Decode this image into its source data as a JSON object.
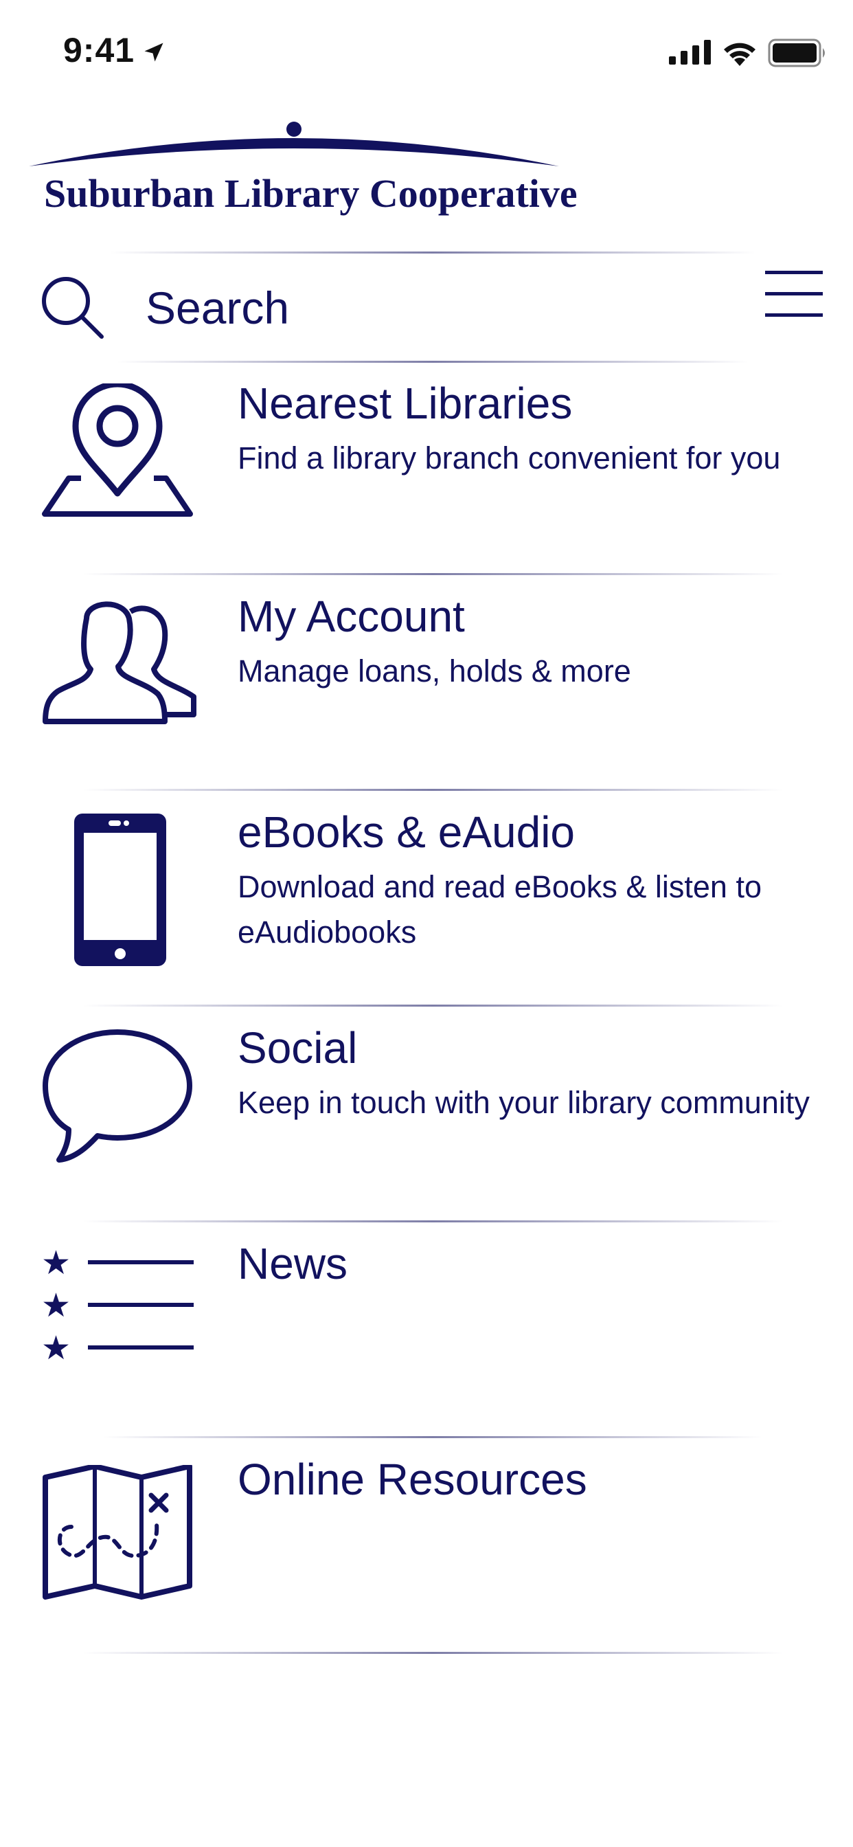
{
  "status_bar": {
    "time": "9:41",
    "icons": [
      "location-arrow-icon",
      "signal-icon",
      "wifi-icon",
      "battery-icon"
    ]
  },
  "header": {
    "logo_text": "Suburban Library Cooperative"
  },
  "search": {
    "placeholder": "Search",
    "value": ""
  },
  "menu": {
    "items": [
      {
        "title": "Nearest Libraries",
        "subtitle": "Find a library branch convenient for you",
        "icon": "map-pin-icon"
      },
      {
        "title": "My Account",
        "subtitle": "Manage loans, holds & more",
        "icon": "users-icon"
      },
      {
        "title": "eBooks & eAudio",
        "subtitle": "Download and read eBooks & listen to eAudiobooks",
        "icon": "phone-icon"
      },
      {
        "title": "Social",
        "subtitle": "Keep in touch with your library community",
        "icon": "speech-bubble-icon"
      },
      {
        "title": "News",
        "subtitle": "",
        "icon": "star-list-icon"
      },
      {
        "title": "Online Resources",
        "subtitle": "",
        "icon": "treasure-map-icon"
      }
    ]
  },
  "colors": {
    "primary": "#12125e",
    "background": "#ffffff"
  }
}
